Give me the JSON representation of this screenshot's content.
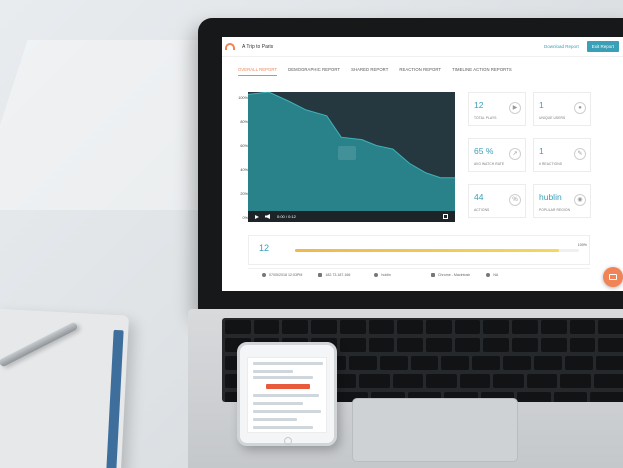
{
  "app": {
    "title": "A Trip to Paris",
    "download_label": "Download Report",
    "exit_label": "Exit Report"
  },
  "tabs": [
    {
      "label": "OVERALL REPORT",
      "active": true
    },
    {
      "label": "DEMOGRAPHIC REPORT",
      "active": false
    },
    {
      "label": "SHARED REPORT",
      "active": false
    },
    {
      "label": "REACTION REPORT",
      "active": false
    },
    {
      "label": "TIMELINE ACTION REPORTS",
      "active": false
    }
  ],
  "chart_data": {
    "type": "area",
    "yticks": [
      "100%",
      "80%",
      "60%",
      "40%",
      "20%",
      "0%"
    ],
    "ylim": [
      0,
      100
    ],
    "x": [
      0,
      0.1,
      0.2,
      0.28,
      0.38,
      0.45,
      0.55,
      0.62,
      0.7,
      0.78,
      0.86,
      0.93,
      1.0
    ],
    "values": [
      98,
      100,
      92,
      85,
      80,
      62,
      60,
      55,
      52,
      40,
      32,
      28,
      28
    ]
  },
  "video": {
    "time": "0:00 / 0:12"
  },
  "stats": [
    {
      "value": "12",
      "label": "TOTAL PLAYS",
      "icon": "play-icon"
    },
    {
      "value": "1",
      "label": "UNIQUE USERS",
      "icon": "user-icon"
    },
    {
      "value": "65 %",
      "label": "AVG WATCH RATE",
      "icon": "trend-icon"
    },
    {
      "value": "1",
      "label": "# REACTIONS",
      "icon": "reaction-icon"
    },
    {
      "value": "44",
      "label": "ACTIONS",
      "icon": "percent-icon"
    },
    {
      "value": "hublin",
      "label": "POPULAR REGION",
      "icon": "location-icon"
    }
  ],
  "progress": {
    "value": "12",
    "percent_label": "100%",
    "fill": 0.93
  },
  "info": [
    {
      "text": "07/05/2018 12:03PM",
      "icon": "clock-icon"
    },
    {
      "text": "182.73.187.166",
      "icon": "globe-icon"
    },
    {
      "text": "hublin",
      "icon": "pin-icon"
    },
    {
      "text": "Chrome - Macintosh",
      "icon": "monitor-icon"
    },
    {
      "text": "NA",
      "icon": "person-icon"
    }
  ],
  "colors": {
    "accent": "#f08457",
    "teal": "#3aa0b8",
    "area_fill": "#2a8f98"
  }
}
